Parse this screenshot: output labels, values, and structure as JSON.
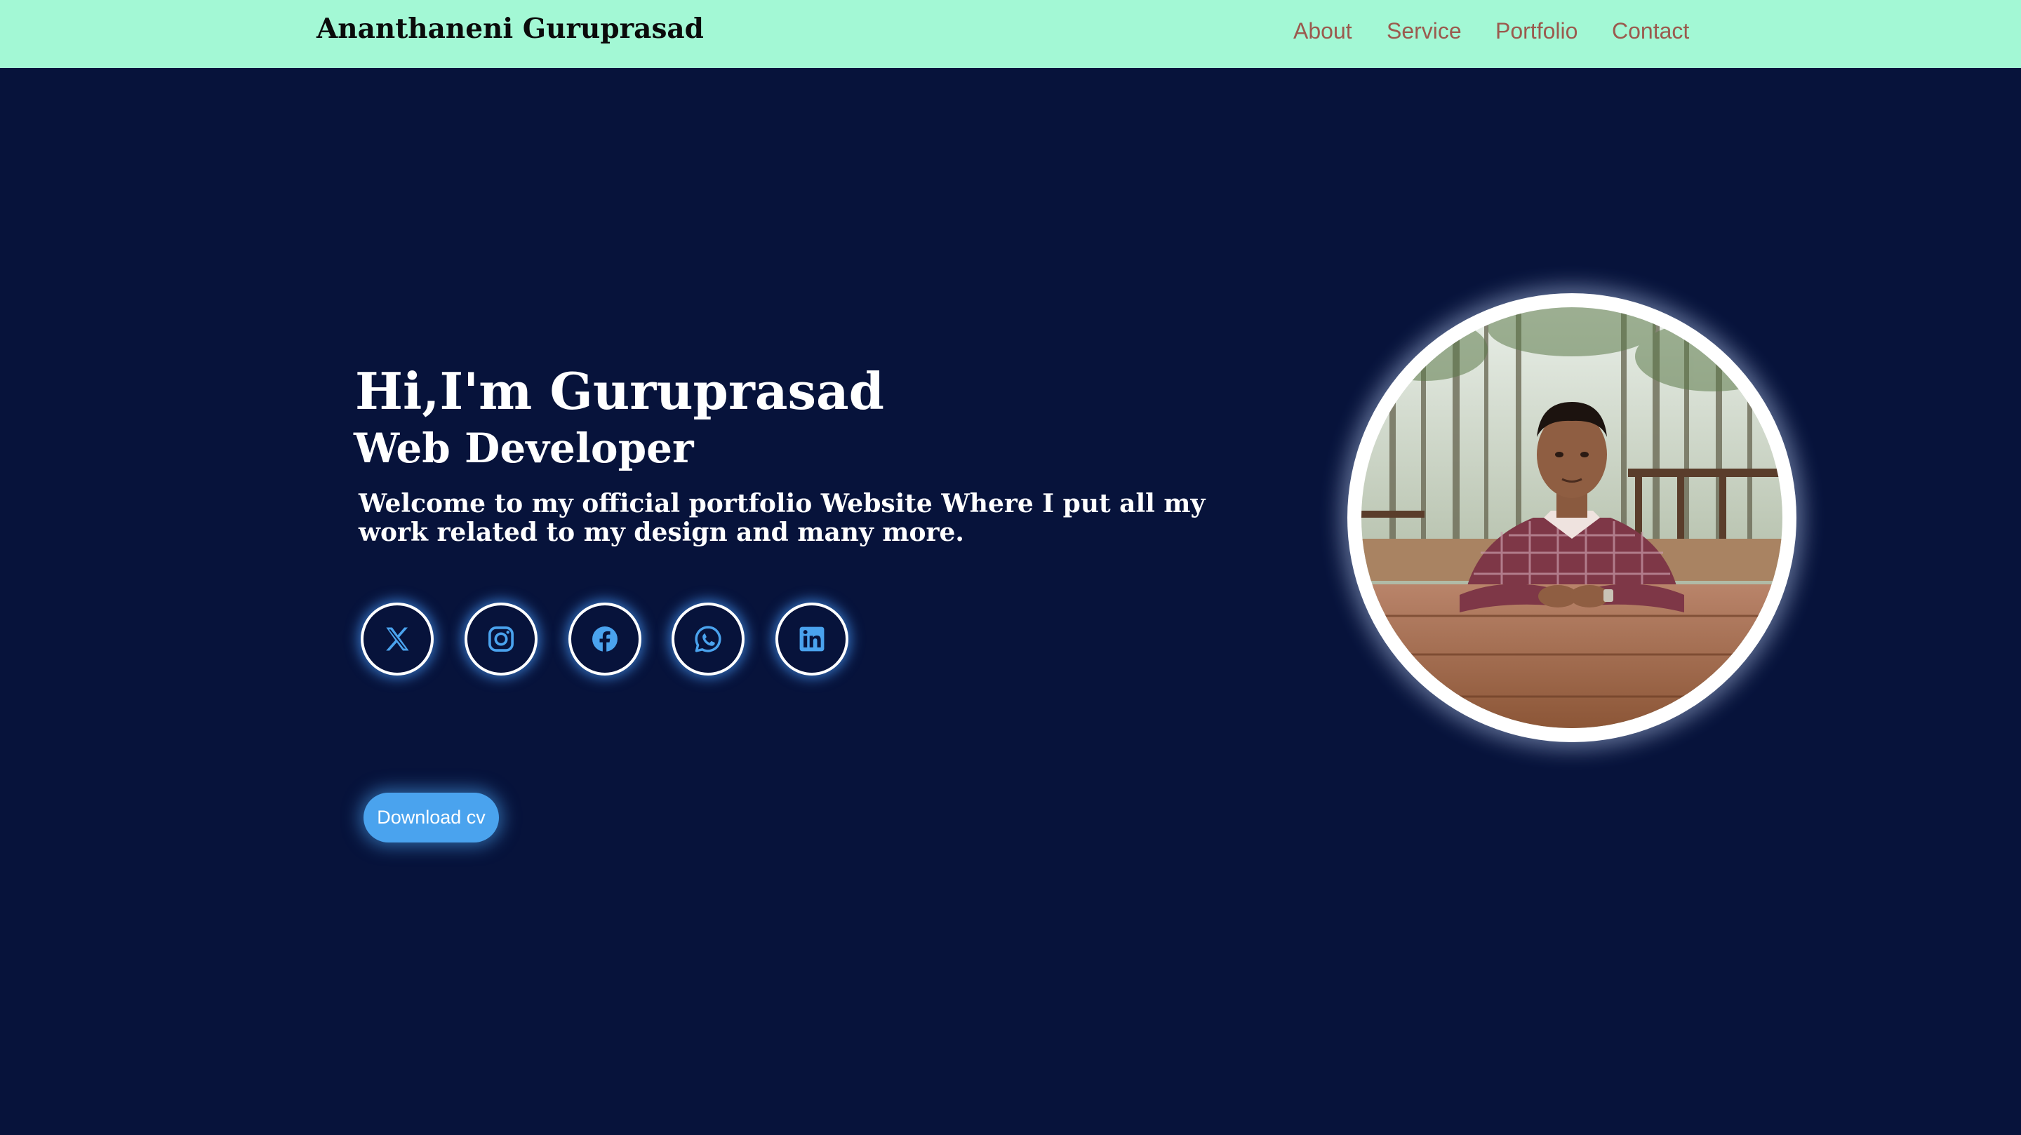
{
  "header": {
    "brand": "Ananthaneni Guruprasad",
    "nav": {
      "about": "About",
      "service": "Service",
      "portfolio": "Portfolio",
      "contact": "Contact"
    }
  },
  "hero": {
    "title": "Hi,I'm Guruprasad",
    "role": "Web Developer",
    "description": "Welcome to my official portfolio Website Where I put all my work related to my design and many more."
  },
  "social_icons": [
    "x-icon",
    "instagram-icon",
    "facebook-icon",
    "whatsapp-icon",
    "linkedin-icon"
  ],
  "download_button": {
    "label": "Download cv"
  },
  "profile_photo": {
    "content": "young man in plaid shirt seated at wooden table with trees behind"
  },
  "colors": {
    "header_bg": "#a3f8d5",
    "page_bg": "#07133b",
    "nav_text": "#9b5a4e",
    "accent": "#4aa3ee",
    "text": "#ffffff"
  }
}
